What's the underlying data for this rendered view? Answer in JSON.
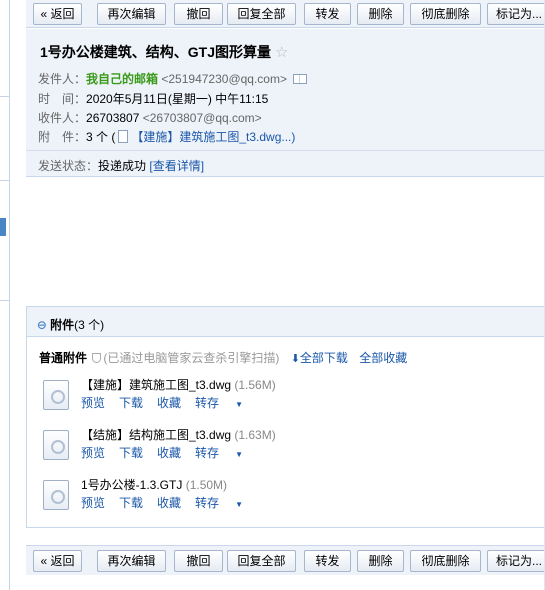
{
  "toolbar": {
    "buttons": [
      {
        "label": "« 返回"
      },
      {
        "label": "再次编辑"
      },
      {
        "label": "撤回"
      },
      {
        "label": "回复全部"
      },
      {
        "label": "转发"
      },
      {
        "label": "删除"
      },
      {
        "label": "彻底删除"
      },
      {
        "label": "标记为..."
      }
    ]
  },
  "mail": {
    "subject": "1号办公楼建筑、结构、GTJ图形算量",
    "sender_label": "发件人：",
    "sender_name": "我自己的邮箱",
    "sender_addr": "<251947230@qq.com>",
    "time_label": "时　间：",
    "time_value": "2020年5月11日(星期一) 中午11:15",
    "recipient_label": "收件人：",
    "recipient_name": "26703807",
    "recipient_addr": "<26703807@qq.com>",
    "attach_label": "附　件：",
    "attach_count": "3 个 (",
    "attach_preview": "【建施】建筑施工图_t3.dwg...)",
    "status_label": "发送状态：",
    "status_value": "投递成功",
    "status_link": "[查看详情]"
  },
  "attachments": {
    "title": "附件",
    "count": "(3 个)",
    "normal_label": "普通附件",
    "scan_text": "(已通过电脑管家云查杀引擎扫描)",
    "download_all": "全部下载",
    "save_all": "全部收藏",
    "items": [
      {
        "name": "【建施】建筑施工图_t3.dwg",
        "size": "(1.56M)"
      },
      {
        "name": "【结施】结构施工图_t3.dwg",
        "size": "(1.63M)"
      },
      {
        "name": "1号办公楼-1.3.GTJ",
        "size": "(1.50M)"
      }
    ],
    "actions": {
      "preview": "预览",
      "download": "下载",
      "save": "收藏",
      "forward": "转存"
    }
  }
}
